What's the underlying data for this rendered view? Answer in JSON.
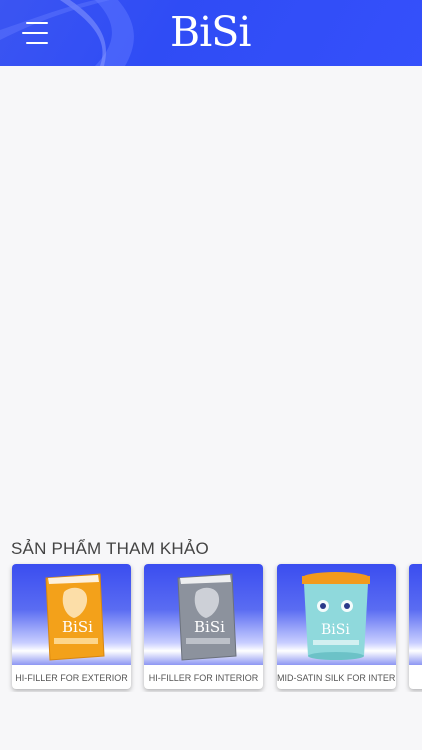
{
  "header": {
    "logo_text": "BiSi",
    "menu_icon": "hamburger-menu-icon",
    "background_color": "#3550fb"
  },
  "section": {
    "title": "SẢN PHẨM THAM KHẢO"
  },
  "products": [
    {
      "name": "HI-FILLER FOR EXTERIOR",
      "package": "bag",
      "accent": "#f0a21c"
    },
    {
      "name": "HI-FILLER FOR INTERIOR",
      "package": "bag",
      "accent": "#8a8f99"
    },
    {
      "name": "MID-SATIN SILK FOR INTERIOR",
      "package": "bucket",
      "accent": "#7fd3d8"
    },
    {
      "name": "",
      "package": "partial",
      "accent": "#3550fb"
    }
  ]
}
